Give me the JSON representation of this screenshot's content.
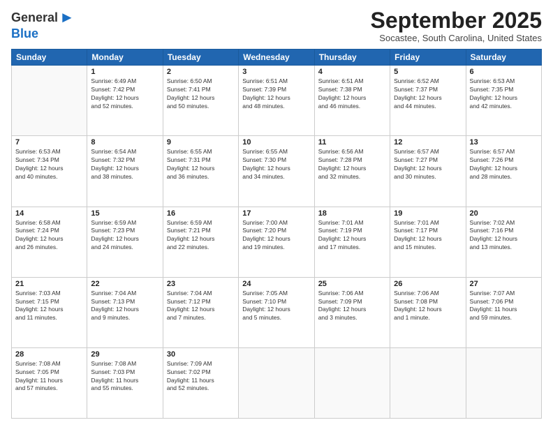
{
  "logo": {
    "general": "General",
    "blue": "Blue"
  },
  "header": {
    "month": "September 2025",
    "location": "Socastee, South Carolina, United States"
  },
  "weekdays": [
    "Sunday",
    "Monday",
    "Tuesday",
    "Wednesday",
    "Thursday",
    "Friday",
    "Saturday"
  ],
  "weeks": [
    [
      {
        "day": "",
        "info": ""
      },
      {
        "day": "1",
        "info": "Sunrise: 6:49 AM\nSunset: 7:42 PM\nDaylight: 12 hours\nand 52 minutes."
      },
      {
        "day": "2",
        "info": "Sunrise: 6:50 AM\nSunset: 7:41 PM\nDaylight: 12 hours\nand 50 minutes."
      },
      {
        "day": "3",
        "info": "Sunrise: 6:51 AM\nSunset: 7:39 PM\nDaylight: 12 hours\nand 48 minutes."
      },
      {
        "day": "4",
        "info": "Sunrise: 6:51 AM\nSunset: 7:38 PM\nDaylight: 12 hours\nand 46 minutes."
      },
      {
        "day": "5",
        "info": "Sunrise: 6:52 AM\nSunset: 7:37 PM\nDaylight: 12 hours\nand 44 minutes."
      },
      {
        "day": "6",
        "info": "Sunrise: 6:53 AM\nSunset: 7:35 PM\nDaylight: 12 hours\nand 42 minutes."
      }
    ],
    [
      {
        "day": "7",
        "info": "Sunrise: 6:53 AM\nSunset: 7:34 PM\nDaylight: 12 hours\nand 40 minutes."
      },
      {
        "day": "8",
        "info": "Sunrise: 6:54 AM\nSunset: 7:32 PM\nDaylight: 12 hours\nand 38 minutes."
      },
      {
        "day": "9",
        "info": "Sunrise: 6:55 AM\nSunset: 7:31 PM\nDaylight: 12 hours\nand 36 minutes."
      },
      {
        "day": "10",
        "info": "Sunrise: 6:55 AM\nSunset: 7:30 PM\nDaylight: 12 hours\nand 34 minutes."
      },
      {
        "day": "11",
        "info": "Sunrise: 6:56 AM\nSunset: 7:28 PM\nDaylight: 12 hours\nand 32 minutes."
      },
      {
        "day": "12",
        "info": "Sunrise: 6:57 AM\nSunset: 7:27 PM\nDaylight: 12 hours\nand 30 minutes."
      },
      {
        "day": "13",
        "info": "Sunrise: 6:57 AM\nSunset: 7:26 PM\nDaylight: 12 hours\nand 28 minutes."
      }
    ],
    [
      {
        "day": "14",
        "info": "Sunrise: 6:58 AM\nSunset: 7:24 PM\nDaylight: 12 hours\nand 26 minutes."
      },
      {
        "day": "15",
        "info": "Sunrise: 6:59 AM\nSunset: 7:23 PM\nDaylight: 12 hours\nand 24 minutes."
      },
      {
        "day": "16",
        "info": "Sunrise: 6:59 AM\nSunset: 7:21 PM\nDaylight: 12 hours\nand 22 minutes."
      },
      {
        "day": "17",
        "info": "Sunrise: 7:00 AM\nSunset: 7:20 PM\nDaylight: 12 hours\nand 19 minutes."
      },
      {
        "day": "18",
        "info": "Sunrise: 7:01 AM\nSunset: 7:19 PM\nDaylight: 12 hours\nand 17 minutes."
      },
      {
        "day": "19",
        "info": "Sunrise: 7:01 AM\nSunset: 7:17 PM\nDaylight: 12 hours\nand 15 minutes."
      },
      {
        "day": "20",
        "info": "Sunrise: 7:02 AM\nSunset: 7:16 PM\nDaylight: 12 hours\nand 13 minutes."
      }
    ],
    [
      {
        "day": "21",
        "info": "Sunrise: 7:03 AM\nSunset: 7:15 PM\nDaylight: 12 hours\nand 11 minutes."
      },
      {
        "day": "22",
        "info": "Sunrise: 7:04 AM\nSunset: 7:13 PM\nDaylight: 12 hours\nand 9 minutes."
      },
      {
        "day": "23",
        "info": "Sunrise: 7:04 AM\nSunset: 7:12 PM\nDaylight: 12 hours\nand 7 minutes."
      },
      {
        "day": "24",
        "info": "Sunrise: 7:05 AM\nSunset: 7:10 PM\nDaylight: 12 hours\nand 5 minutes."
      },
      {
        "day": "25",
        "info": "Sunrise: 7:06 AM\nSunset: 7:09 PM\nDaylight: 12 hours\nand 3 minutes."
      },
      {
        "day": "26",
        "info": "Sunrise: 7:06 AM\nSunset: 7:08 PM\nDaylight: 12 hours\nand 1 minute."
      },
      {
        "day": "27",
        "info": "Sunrise: 7:07 AM\nSunset: 7:06 PM\nDaylight: 11 hours\nand 59 minutes."
      }
    ],
    [
      {
        "day": "28",
        "info": "Sunrise: 7:08 AM\nSunset: 7:05 PM\nDaylight: 11 hours\nand 57 minutes."
      },
      {
        "day": "29",
        "info": "Sunrise: 7:08 AM\nSunset: 7:03 PM\nDaylight: 11 hours\nand 55 minutes."
      },
      {
        "day": "30",
        "info": "Sunrise: 7:09 AM\nSunset: 7:02 PM\nDaylight: 11 hours\nand 52 minutes."
      },
      {
        "day": "",
        "info": ""
      },
      {
        "day": "",
        "info": ""
      },
      {
        "day": "",
        "info": ""
      },
      {
        "day": "",
        "info": ""
      }
    ]
  ]
}
